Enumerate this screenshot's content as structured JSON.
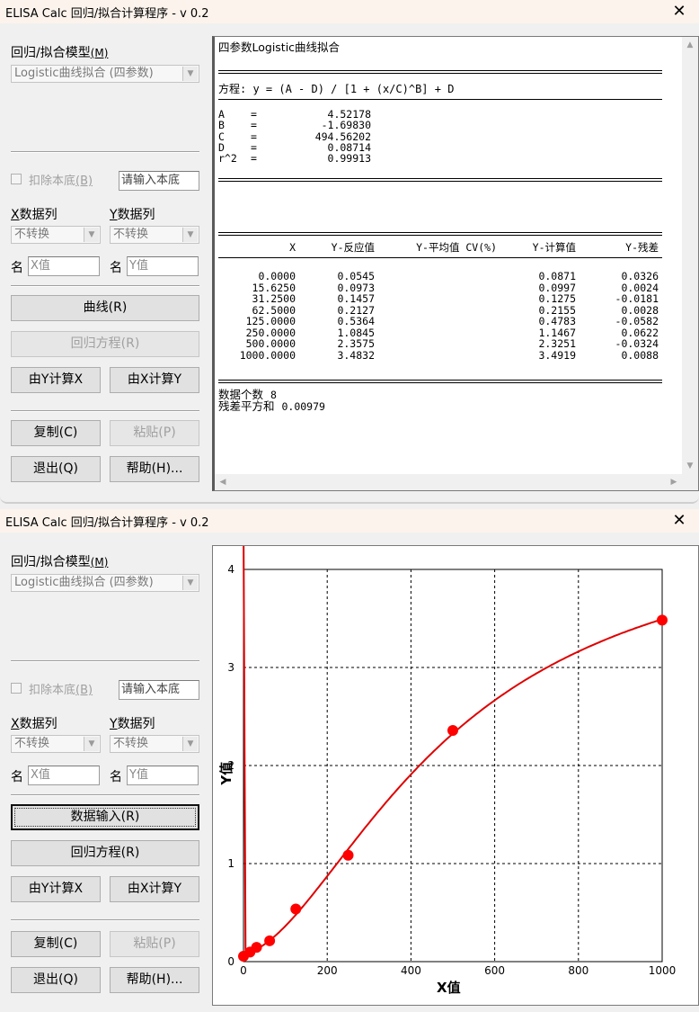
{
  "app_title": "ELISA Calc 回归/拟合计算程序 - v 0.2",
  "close_glyph": "✕",
  "left": {
    "model_label": "回归/拟合模型",
    "model_hotkey": "(M)",
    "model_value": "Logistic曲线拟合 (四参数)",
    "deduct_label": "扣除本底",
    "deduct_hotkey": "(B)",
    "background_placeholder": "请输入本底",
    "x_col_label": "数据列",
    "x_col_letter": "X",
    "y_col_label": "数据列",
    "y_col_letter": "Y",
    "x_transform": "不转换",
    "y_transform": "不转换",
    "name_label": "名",
    "x_name": "X值",
    "y_name": "Y值",
    "btn_curve": "曲线(R)",
    "btn_data_input": "数据输入(R)",
    "btn_reg_eq": "回归方程(R)",
    "btn_calc_x": "由Y计算X",
    "btn_calc_y": "由X计算Y",
    "btn_copy": "复制(C)",
    "btn_paste": "粘贴(P)",
    "btn_exit": "退出(Q)",
    "btn_help": "帮助(H)..."
  },
  "result": {
    "title": "四参数Logistic曲线拟合",
    "equation": "方程: y = (A - D) / [1 + (x/C)^B] + D",
    "params": [
      {
        "name": "A",
        "eq": "=",
        "value": "4.52178"
      },
      {
        "name": "B",
        "eq": "=",
        "value": "-1.69830"
      },
      {
        "name": "C",
        "eq": "=",
        "value": "494.56202"
      },
      {
        "name": "D",
        "eq": "=",
        "value": "0.08714"
      },
      {
        "name": "r^2",
        "eq": "=",
        "value": "0.99913"
      }
    ],
    "columns": [
      "X",
      "Y-反应值",
      "Y-平均值 CV(%)",
      "Y-计算值",
      "Y-残差"
    ],
    "rows": [
      [
        "0.0000",
        "0.0545",
        "",
        "0.0871",
        "0.0326"
      ],
      [
        "15.6250",
        "0.0973",
        "",
        "0.0997",
        "0.0024"
      ],
      [
        "31.2500",
        "0.1457",
        "",
        "0.1275",
        "-0.0181"
      ],
      [
        "62.5000",
        "0.2127",
        "",
        "0.2155",
        "0.0028"
      ],
      [
        "125.0000",
        "0.5364",
        "",
        "0.4783",
        "-0.0582"
      ],
      [
        "250.0000",
        "1.0845",
        "",
        "1.1467",
        "0.0622"
      ],
      [
        "500.0000",
        "2.3575",
        "",
        "2.3251",
        "-0.0324"
      ],
      [
        "1000.0000",
        "3.4832",
        "",
        "3.4919",
        "0.0088"
      ]
    ],
    "count_label": "数据个数",
    "count_value": "8",
    "rss_label": "残差平方和",
    "rss_value": "0.00979"
  },
  "chart_data": {
    "type": "scatter",
    "xlabel": "X值",
    "ylabel": "Y值",
    "xlim": [
      0,
      1000
    ],
    "ylim": [
      0,
      4
    ],
    "xticks": [
      0,
      200,
      400,
      600,
      800,
      1000
    ],
    "yticks": [
      0,
      1,
      2,
      3,
      4
    ],
    "grid": true,
    "points": {
      "x": [
        0,
        15.625,
        31.25,
        62.5,
        125,
        250,
        500,
        1000
      ],
      "y": [
        0.0545,
        0.0973,
        0.1457,
        0.2127,
        0.5364,
        1.0845,
        2.3575,
        3.4832
      ]
    },
    "fit": {
      "A": 4.52178,
      "B": -1.6983,
      "C": 494.56202,
      "D": 0.08714
    },
    "point_color": "#ff0000",
    "line_color": "#e00000"
  }
}
